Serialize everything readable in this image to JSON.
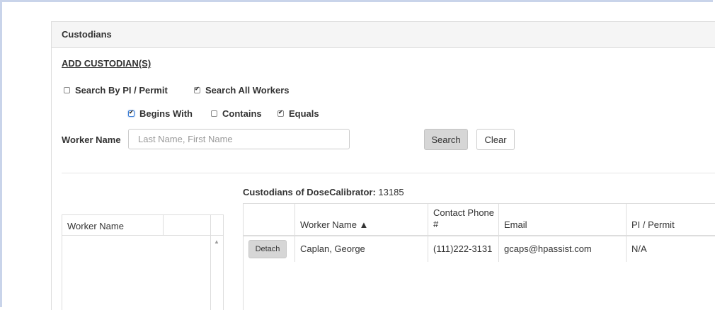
{
  "panel": {
    "title": "Custodians"
  },
  "add_link": "ADD CUSTODIAN(S)",
  "search_options": {
    "search_by_pi": {
      "label": "Search By PI / Permit",
      "checked": false
    },
    "search_all_workers": {
      "label": "Search All Workers",
      "checked": true
    }
  },
  "match_options": {
    "begins_with": {
      "label": "Begins With",
      "checked": true
    },
    "contains": {
      "label": "Contains",
      "checked": false
    },
    "equals": {
      "label": "Equals",
      "checked": true
    }
  },
  "worker_name": {
    "label": "Worker Name",
    "placeholder": "Last Name, First Name",
    "value": ""
  },
  "buttons": {
    "search": "Search",
    "clear": "Clear"
  },
  "left_grid": {
    "header": "Worker Name"
  },
  "custodians": {
    "title_label": "Custodians of DoseCalibrator:",
    "title_value": "13185",
    "columns": [
      "Worker Name ▲",
      "Contact Phone #",
      "Email",
      "PI / Permit"
    ],
    "rows": [
      {
        "action": "Detach",
        "worker_name": "Caplan, George",
        "phone": "(111)222-3131",
        "email": "gcaps@hpassist.com",
        "pi_permit": "N/A"
      }
    ]
  }
}
